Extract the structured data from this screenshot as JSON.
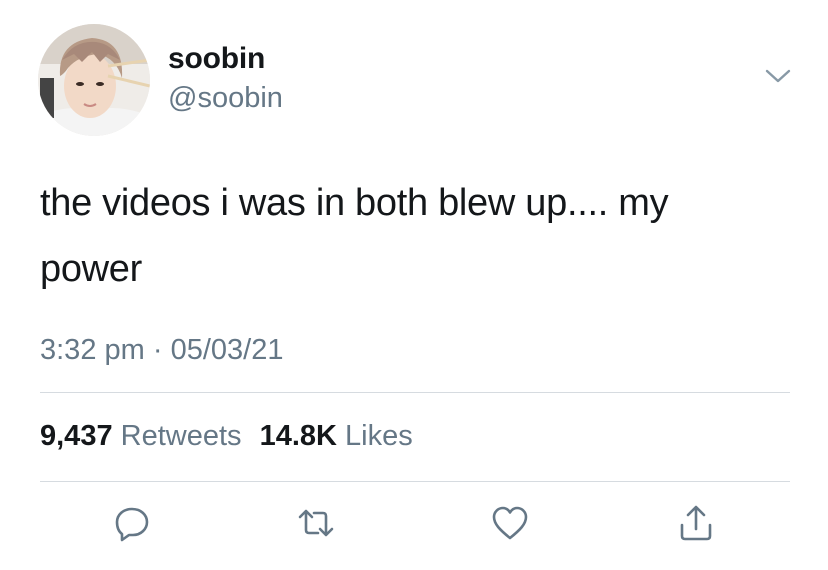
{
  "user": {
    "display_name": "soobin",
    "handle": "@soobin",
    "avatar_icon": "profile-photo"
  },
  "tweet": {
    "text_lines": [
      "the videos i was in both blew up.... my",
      "power"
    ],
    "time": "3:32 pm",
    "separator": "·",
    "date": "05/03/21"
  },
  "stats": {
    "retweets_count": "9,437",
    "retweets_label": "Retweets",
    "likes_count": "14.8K",
    "likes_label": "Likes"
  },
  "icons": {
    "menu": "chevron-down-icon",
    "reply": "reply-icon",
    "retweet": "retweet-icon",
    "like": "heart-icon",
    "share": "share-icon"
  },
  "colors": {
    "text": "#14171a",
    "secondary": "#657786",
    "divider": "#d6dbe0"
  }
}
